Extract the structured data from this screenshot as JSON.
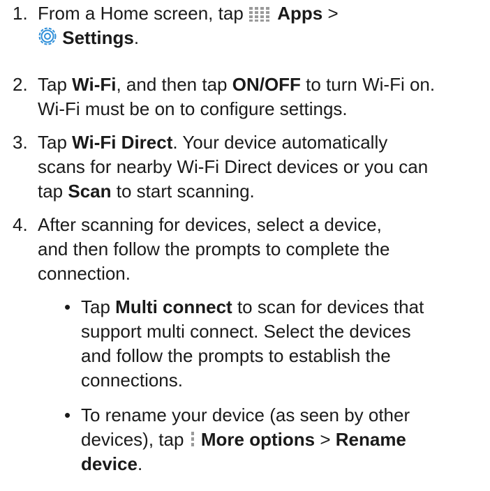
{
  "steps": [
    {
      "num": "1.",
      "t1": "From a Home screen, tap ",
      "apps": "Apps",
      "sep": " >",
      "settings": "Settings",
      "end": "."
    },
    {
      "num": "2.",
      "t1": "Tap ",
      "wifi": "Wi-Fi",
      "t2": ", and then tap ",
      "onoff": "ON/OFF",
      "t3": " to turn Wi-Fi on.",
      "t4": "Wi-Fi must be on to configure settings."
    },
    {
      "num": "3.",
      "t1": "Tap ",
      "direct": "Wi-Fi Direct",
      "t2": ". Your device automatically",
      "t3": "scans for nearby Wi-Fi Direct devices or you can",
      "t4": "tap ",
      "scan": "Scan",
      "t5": " to start scanning."
    },
    {
      "num": "4.",
      "t1": "After scanning for devices, select a device,",
      "t2": "and then follow the prompts to complete the",
      "t3": "connection."
    }
  ],
  "bullets": [
    {
      "dot": "•",
      "t1": "Tap ",
      "multi": "Multi connect",
      "t2": " to scan for devices that",
      "t3": "support multi connect. Select the devices",
      "t4": "and follow the prompts to establish the",
      "t5": "connections."
    },
    {
      "dot": "•",
      "t1": "To rename your device (as seen by other",
      "t2": "devices), tap ",
      "more": "More options",
      "sep": " > ",
      "rename1": "Rename",
      "rename2": "device",
      "end": "."
    }
  ],
  "icons": {
    "apps": "apps-grid-icon",
    "settings": "settings-gear-icon",
    "more": "more-options-icon"
  },
  "colors": {
    "text": "#1a1a1a",
    "icon_gray": "#9a9a9a",
    "gear_blue": "#2f8fd8"
  }
}
